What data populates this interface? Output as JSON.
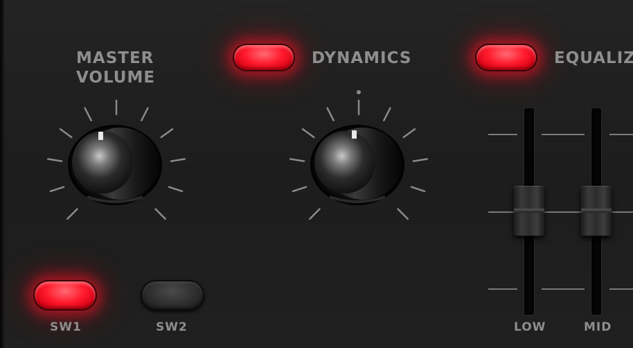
{
  "master_volume": {
    "label_line1": "MASTER",
    "label_line2": "VOLUME"
  },
  "dynamics": {
    "label": "DYNAMICS",
    "led_state": "on"
  },
  "equalizer": {
    "label": "EQUALIZ",
    "led_state": "on",
    "bands": [
      {
        "label": "LOW"
      },
      {
        "label": "MID"
      }
    ]
  },
  "switches": [
    {
      "label": "SW1",
      "state": "on"
    },
    {
      "label": "SW2",
      "state": "off"
    }
  ],
  "colors": {
    "led_on": "#ff1a2c",
    "led_off": "#2e2e2e",
    "label_text": "#8e8e8e",
    "panel": "#1c1c1c"
  }
}
